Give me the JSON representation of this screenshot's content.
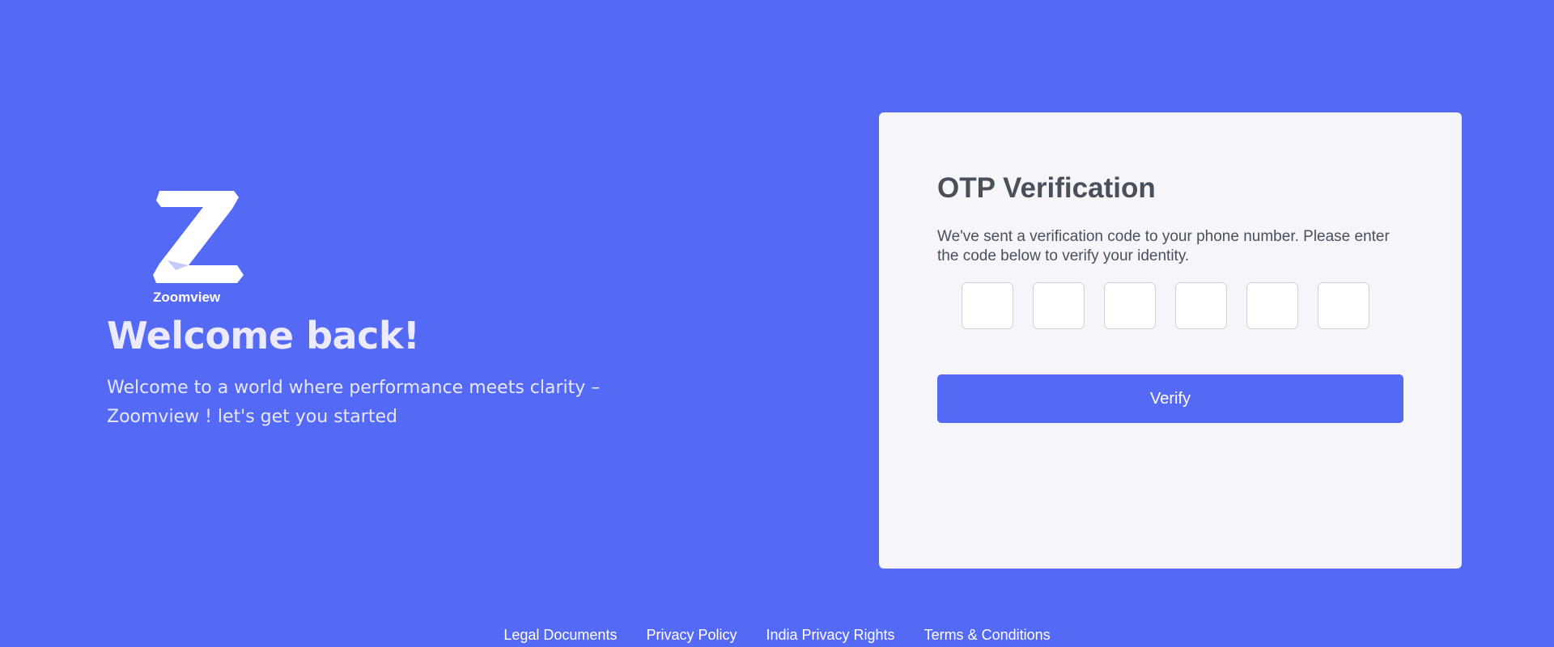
{
  "brand": {
    "logo_text": "Zoomview"
  },
  "hero": {
    "title": "Welcome back!",
    "subtitle": "Welcome to a world where performance meets clarity – Zoomview ! let's get you started"
  },
  "otp_card": {
    "title": "OTP Verification",
    "description": "We've sent a verification code to your phone number. Please enter the code below to verify your identity.",
    "digits": [
      "",
      "",
      "",
      "",
      "",
      ""
    ],
    "verify_label": "Verify"
  },
  "footer": {
    "links": [
      "Legal Documents",
      "Privacy Policy",
      "India Privacy Rights",
      "Terms & Conditions"
    ]
  },
  "colors": {
    "background": "#5469f4",
    "card": "#f5f5fa",
    "button": "#5469f4",
    "heading_text": "#4a5059"
  }
}
